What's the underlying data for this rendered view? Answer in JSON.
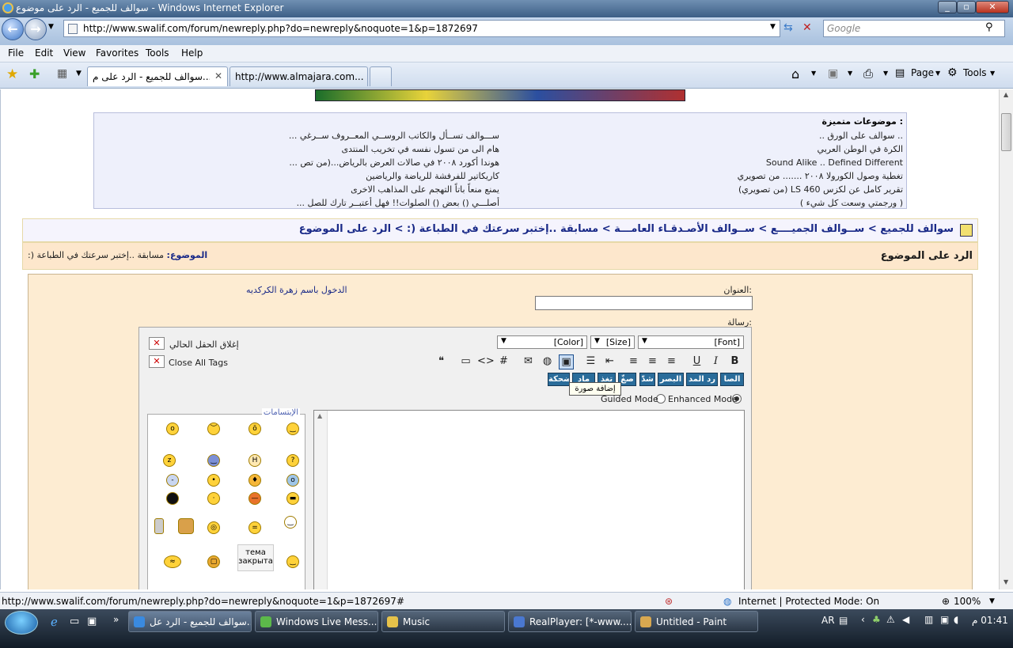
{
  "window": {
    "title": "سوالف للجميع - الرد على موضوع - Windows Internet Explorer"
  },
  "nav": {
    "url": "http://www.swalif.com/forum/newreply.php?do=newreply&noquote=1&p=1872697",
    "search_placeholder": "Google"
  },
  "menu": [
    "File",
    "Edit",
    "View",
    "Favorites",
    "Tools",
    "Help"
  ],
  "tabs": [
    {
      "label": "سوالف للجميع - الرد على م...",
      "active": true
    },
    {
      "label": "http://www.almajara.com...",
      "active": false
    }
  ],
  "cmdbar": {
    "page": "Page",
    "tools": "Tools"
  },
  "featured": {
    "heading": "موضوعات متميزة :",
    "right": [
      ".. سوالف على الورق ..",
      "الكرة في الوطن العربي",
      "Sound Alike .. Defined Different",
      "تغطية وصول الكورولا ٢٠٠٨ ....... من تصويري",
      "تقرير كامل عن لكزس 460 LS (من تصويري)",
      "( ورجمتي وسعت كل شيء )"
    ],
    "left": [
      "ســـوالف تســأل والكاتب الروســي المعــروف ســرغي ...",
      "هام الى من تسول نفسه في تخريب المنتدى",
      "هوندا أكورد ٢٠٠٨ في صالات العرض بالرياض...(من تص ...",
      "كاريكاتير للفرفشة للرياضة والرياضين",
      "يمنع منعاً باتاً التهجم على المذاهب الاخرى",
      "أصلـــي () بعض () الصلوات!! فهل أعتبــر تارك للصل ..."
    ]
  },
  "breadcrumb": "سوالف للجميع > ســوالف الجميــــع > ســوالف الأصـدقـاء العامـــة > مسابقة ..إختبر سرعتك في الطباعة (: > الرد على الموضوع",
  "reply": {
    "title": "الرد على الموضوع",
    "topic_label": "الموضوع:",
    "topic": "مسابقة ..إختبر سرعتك في الطباعة (:"
  },
  "form": {
    "subject_label": "العنوان:",
    "login_as": "الدخول باسم زهرة الكركديه",
    "message_label": "رسالة:",
    "font": "[Font]",
    "size": "[Size]",
    "color": "[Color]",
    "close_current": "إغلاق الحقل الحالي",
    "close_all": "Close All Tags",
    "bbcodes": [
      "الصا",
      "رد المد",
      "البصر",
      "شدّ",
      "صغّ",
      "تغذ",
      "ماد",
      "ضحكة"
    ],
    "tooltip": "إضافة صورة",
    "guided": "Guided Mode",
    "enhanced": "Enhanced Mode",
    "smilies_title": "الإبتسامات",
    "smiley_text": "тема закрыта"
  },
  "status": {
    "url": "http://www.swalif.com/forum/newreply.php?do=newreply&noquote=1&p=1872697#",
    "zone": "Internet | Protected Mode: On",
    "zoom": "100%"
  },
  "taskbar": {
    "items": [
      "سوالف للجميع - الرد عل...",
      "Windows Live Mess...",
      "Music",
      "RealPlayer: [*-www....",
      "Untitled - Paint"
    ],
    "lang": "AR",
    "clock": "01:41 م"
  }
}
